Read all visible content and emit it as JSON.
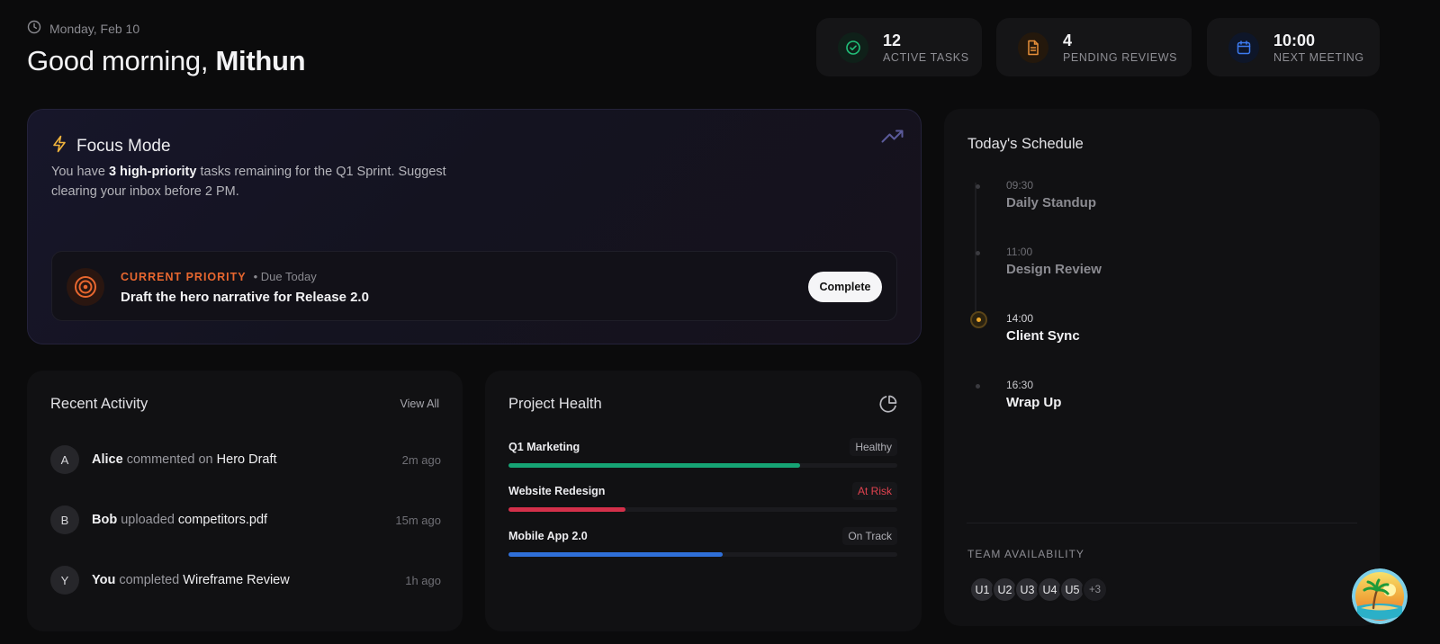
{
  "header": {
    "date": "Monday, Feb 10",
    "greeting_prefix": "Good morning, ",
    "user_name": "Mithun"
  },
  "stats": [
    {
      "value": "12",
      "label": "ACTIVE TASKS",
      "icon": "check-circle-icon",
      "color": "#22c07a"
    },
    {
      "value": "4",
      "label": "PENDING REVIEWS",
      "icon": "document-icon",
      "color": "#e8903a"
    },
    {
      "value": "10:00",
      "label": "NEXT MEETING",
      "icon": "calendar-icon",
      "color": "#3d7bf0"
    }
  ],
  "focus": {
    "title": "Focus Mode",
    "desc_before": "You have ",
    "desc_bold": "3 high-priority",
    "desc_after": " tasks remaining for the Q1 Sprint. Suggest clearing your inbox before 2 PM.",
    "priority_label": "CURRENT PRIORITY",
    "priority_due": "• Due Today",
    "priority_task": "Draft the hero narrative for Release 2.0",
    "complete_label": "Complete"
  },
  "activity": {
    "title": "Recent Activity",
    "view_all": "View All",
    "items": [
      {
        "initial": "A",
        "who": "Alice",
        "action": " commented on ",
        "object": "Hero Draft",
        "time": "2m ago"
      },
      {
        "initial": "B",
        "who": "Bob",
        "action": " uploaded ",
        "object": "competitors.pdf",
        "time": "15m ago"
      },
      {
        "initial": "Y",
        "who": "You",
        "action": " completed ",
        "object": "Wireframe Review",
        "time": "1h ago"
      }
    ]
  },
  "health": {
    "title": "Project Health",
    "projects": [
      {
        "name": "Q1 Marketing",
        "status": "Healthy",
        "progress": 0.75,
        "color": "#16a374"
      },
      {
        "name": "Website Redesign",
        "status": "At Risk",
        "progress": 0.3,
        "color": "#d4304a"
      },
      {
        "name": "Mobile App 2.0",
        "status": "On Track",
        "progress": 0.55,
        "color": "#2f6fd8"
      }
    ]
  },
  "schedule": {
    "title": "Today's Schedule",
    "items": [
      {
        "time": "09:30",
        "title": "Daily Standup"
      },
      {
        "time": "11:00",
        "title": "Design Review"
      },
      {
        "time": "14:00",
        "title": "Client Sync"
      },
      {
        "time": "16:30",
        "title": "Wrap Up"
      }
    ],
    "team_label": "TEAM AVAILABILITY",
    "team": [
      "U1",
      "U2",
      "U3",
      "U4",
      "U5"
    ],
    "team_more": "+3"
  }
}
